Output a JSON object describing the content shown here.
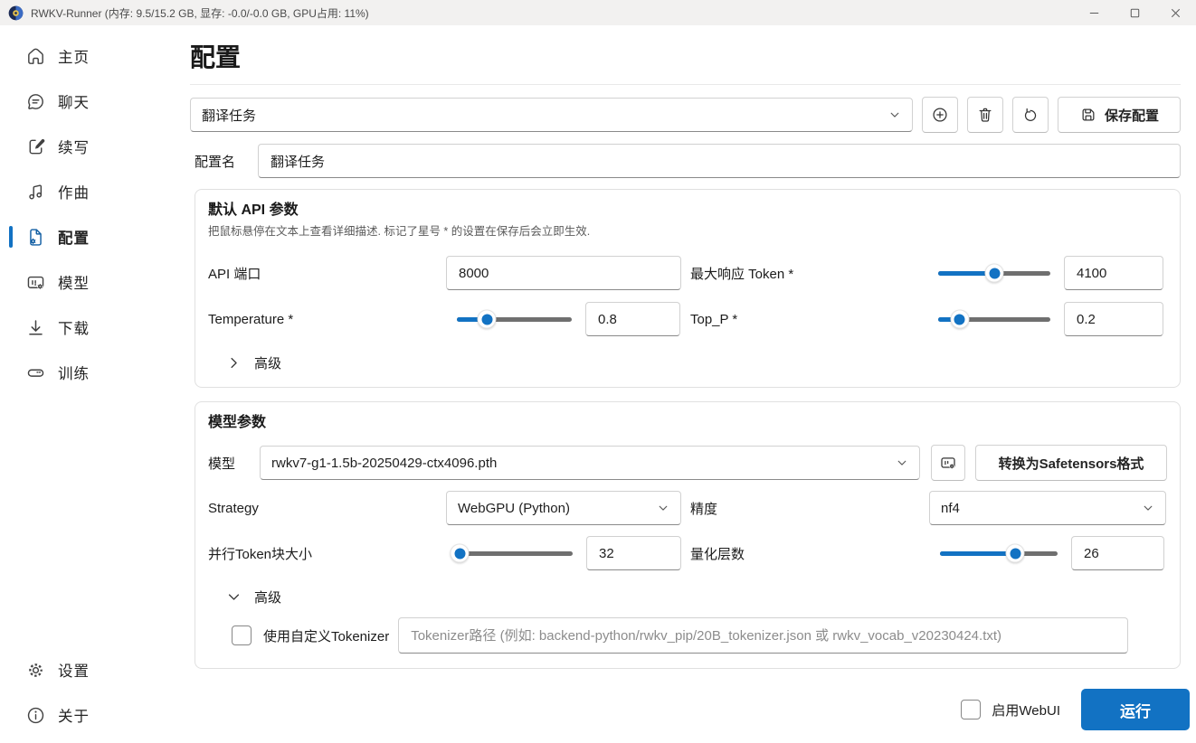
{
  "titlebar": {
    "title": "RWKV-Runner (内存: 9.5/15.2 GB, 显存: -0.0/-0.0 GB, GPU占用: 11%)"
  },
  "sidebar": {
    "items": [
      {
        "label": "主页",
        "icon": "home"
      },
      {
        "label": "聊天",
        "icon": "chat"
      },
      {
        "label": "续写",
        "icon": "completion"
      },
      {
        "label": "作曲",
        "icon": "composition"
      },
      {
        "label": "配置",
        "icon": "config",
        "active": true
      },
      {
        "label": "模型",
        "icon": "models"
      },
      {
        "label": "下载",
        "icon": "downloads"
      },
      {
        "label": "训练",
        "icon": "train"
      }
    ],
    "bottom_items": [
      {
        "label": "设置",
        "icon": "settings"
      },
      {
        "label": "关于",
        "icon": "about"
      }
    ]
  },
  "page": {
    "title": "配置"
  },
  "config_selector": {
    "value": "翻译任务",
    "save_label": "保存配置"
  },
  "config_name": {
    "label": "配置名",
    "value": "翻译任务"
  },
  "api_section": {
    "title": "默认 API 参数",
    "subtitle": "把鼠标悬停在文本上查看详细描述. 标记了星号 * 的设置在保存后会立即生效.",
    "api_port": {
      "label": "API 端口",
      "value": "8000"
    },
    "max_tokens": {
      "label": "最大响应 Token *",
      "value": "4100",
      "percent": 50
    },
    "temperature": {
      "label": "Temperature *",
      "value": "0.8",
      "percent": 26
    },
    "top_p": {
      "label": "Top_P *",
      "value": "0.2",
      "percent": 19
    },
    "advanced_label": "高级"
  },
  "model_section": {
    "title": "模型参数",
    "model": {
      "label": "模型",
      "value": "rwkv7-g1-1.5b-20250429-ctx4096.pth"
    },
    "convert_button": "转换为Safetensors格式",
    "strategy": {
      "label": "Strategy",
      "value": "WebGPU (Python)"
    },
    "precision": {
      "label": "精度",
      "value": "nf4"
    },
    "chunk": {
      "label": "并行Token块大小",
      "value": "32",
      "percent": 4
    },
    "quant": {
      "label": "量化层数",
      "value": "26",
      "percent": 64
    },
    "advanced_label": "高级",
    "tokenizer": {
      "label": "使用自定义Tokenizer",
      "placeholder": "Tokenizer路径 (例如: backend-python/rwkv_pip/20B_tokenizer.json 或 rwkv_vocab_v20230424.txt)"
    }
  },
  "footer": {
    "webui_label": "启用WebUI",
    "run_label": "运行"
  },
  "colors": {
    "accent": "#1272c3",
    "active_icon": "#115ea3"
  }
}
